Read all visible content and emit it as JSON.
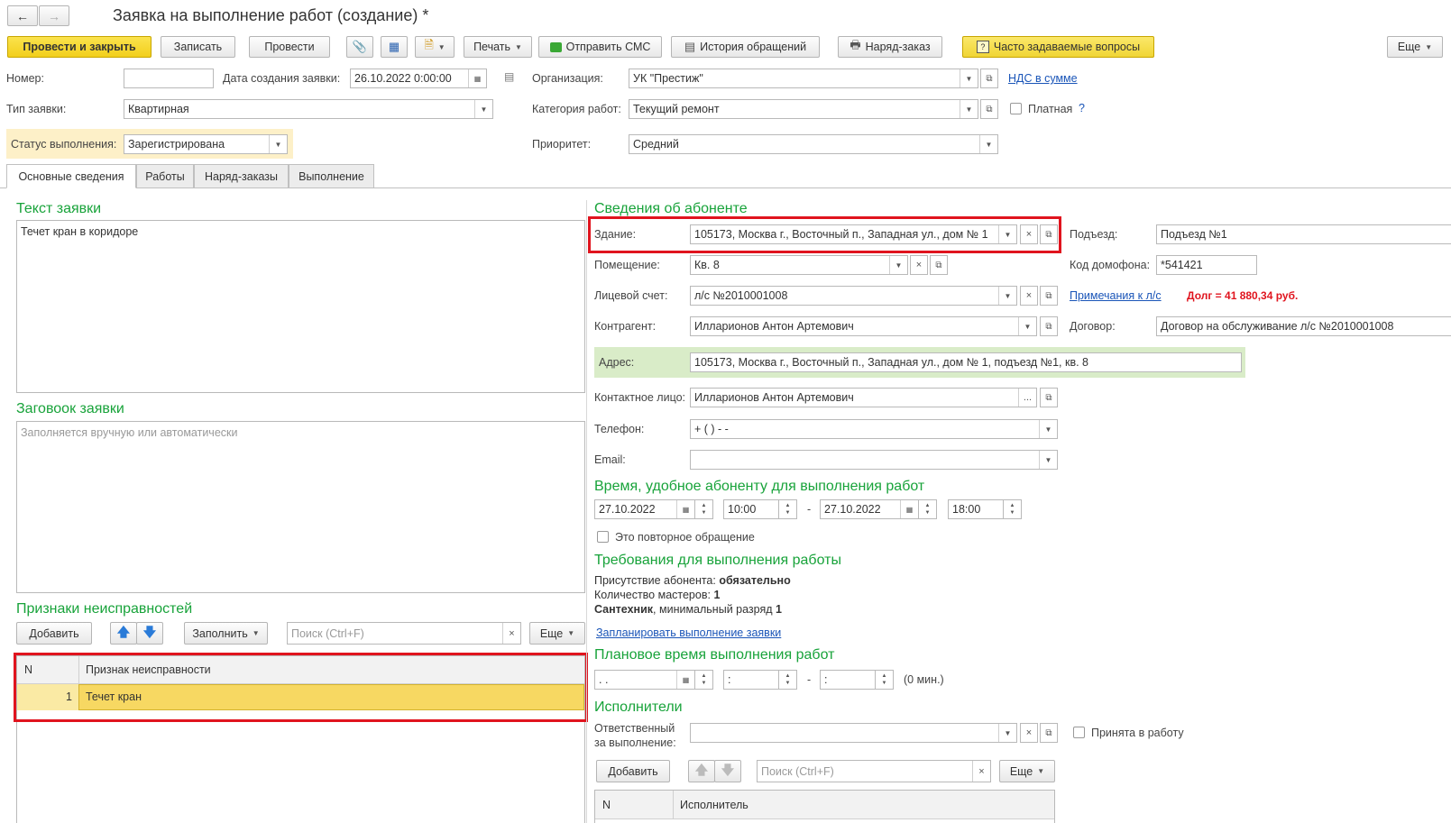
{
  "window": {
    "title": "Заявка на выполнение работ (создание) *"
  },
  "toolbar": {
    "post_close": "Провести и закрыть",
    "save": "Записать",
    "post": "Провести",
    "print": "Печать",
    "send_sms": "Отправить СМС",
    "history": "История обращений",
    "work_order": "Наряд-заказ",
    "faq": "Часто задаваемые вопросы",
    "more": "Еще"
  },
  "header": {
    "number_label": "Номер:",
    "number_value": "",
    "date_label": "Дата создания заявки:",
    "date_value": "26.10.2022  0:00:00",
    "org_label": "Организация:",
    "org_value": "УК \"Престиж\"",
    "vat_link": "НДС в сумме",
    "type_label": "Тип заявки:",
    "type_value": "Квартирная",
    "category_label": "Категория работ:",
    "category_value": "Текущий ремонт",
    "paid_label": "Платная",
    "help_mark": "?",
    "status_label": "Статус выполнения:",
    "status_value": "Зарегистрирована",
    "priority_label": "Приоритет:",
    "priority_value": "Средний"
  },
  "tabs": [
    "Основные сведения",
    "Работы",
    "Наряд-заказы",
    "Выполнение"
  ],
  "left": {
    "request_text_title": "Текст заявки",
    "request_text_value": "Течет кран в коридоре",
    "request_header_title": "Заговоок заявки",
    "request_header_placeholder": "Заполняется вручную или автоматически",
    "faults_title": "Признаки неисправностей",
    "add_button": "Добавить",
    "fill_button": "Заполнить",
    "search_placeholder": "Поиск (Ctrl+F)",
    "more_button": "Еще",
    "table_headers": [
      "N",
      "Признак неисправности"
    ],
    "rows": [
      {
        "n": "1",
        "fault": "Течет кран"
      }
    ]
  },
  "subscriber": {
    "title": "Сведения об абоненте",
    "building_label": "Здание:",
    "building_value": "105173, Москва г., Восточный п., Западная ул., дом № 1",
    "entrance_label": "Подъезд:",
    "entrance_value": "Подъезд №1",
    "room_label": "Помещение:",
    "room_value": "Кв. 8",
    "intercom_label": "Код домофона:",
    "intercom_value": "*541421",
    "account_label": "Лицевой счет:",
    "account_value": "л/с №2010001008",
    "notes_link": "Примечания к л/с",
    "debt": "Долг = 41 880,34 руб.",
    "counterparty_label": "Контрагент:",
    "counterparty_value": "Илларионов Антон Артемович",
    "contract_label": "Договор:",
    "contract_value": "Договор на обслуживание л/с №2010001008",
    "address_label": "Адрес:",
    "address_value": "105173, Москва г., Восточный п., Западная ул., дом № 1, подъезд №1, кв. 8",
    "contact_label": "Контактное лицо:",
    "contact_value": "Илларионов Антон Артемович",
    "phone_label": "Телефон:",
    "phone_value": "+ (   )   -  -",
    "email_label": "Email:",
    "email_value": ""
  },
  "convenient_time": {
    "title": "Время, удобное абоненту для выполнения работ",
    "date_from": "27.10.2022",
    "time_from": "10:00",
    "dash": "-",
    "date_to": "27.10.2022",
    "time_to": "18:00",
    "repeat_label": "Это повторное обращение"
  },
  "requirements": {
    "title": "Требования для выполнения работы",
    "presence_label": "Присутствие абонента:",
    "presence_value": "обязательно",
    "masters_label": "Количество мастеров:",
    "masters_value": "1",
    "trade_value": "Сантехник",
    "rank_label": ", минимальный разряд",
    "rank_value": "1",
    "plan_link": "Запланировать выполнение заявки"
  },
  "planned_time": {
    "title": "Плановое время выполнения работ",
    "date": "  .  .",
    "time_from": "  :",
    "dash": "-",
    "time_to": "  :",
    "duration": "(0 мин.)"
  },
  "executors": {
    "title": "Исполнители",
    "responsible_label_1": "Ответственный",
    "responsible_label_2": "за выполнение:",
    "responsible_value": "",
    "accepted_label": "Принята в работу",
    "add_button": "Добавить",
    "search_placeholder": "Поиск (Ctrl+F)",
    "more_button": "Еще",
    "table_headers": [
      "N",
      "Исполнитель"
    ]
  }
}
